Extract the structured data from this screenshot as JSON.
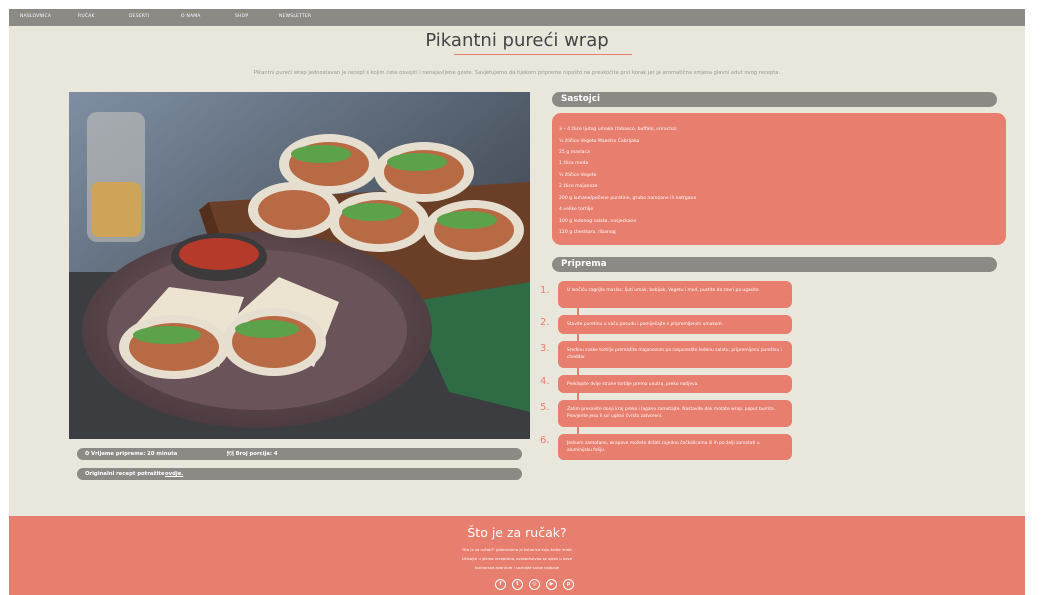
{
  "nav": {
    "items": [
      "NASLOVNICA",
      "RUČAK",
      "DESERTI",
      "O NAMA",
      "SHOP",
      "NEWSLETTER"
    ]
  },
  "header": {
    "title": "Pikantni pureći wrap",
    "intro": "Pikantni pureći wrap jednostavan je recept s kojim ćete osvojiti i nenajavljene goste. Savjetujemo da tijekom pripreme nipošto ne preskočite prvi korak jer je aromatična smjesa glavni adut ovog recepta."
  },
  "info": {
    "prep_time": "⏲ Vrijeme pripreme: 20 minuta",
    "servings": "🍽 Broj porcija: 4",
    "source_text": "Originalni recept potražite",
    "source_link": "ovdje."
  },
  "ingredients": {
    "title": "Sastojci",
    "items": [
      "3 – 4 žlice ljutog umaka (tabasco, buffalo, sriracha)",
      "½ žličice Vegeta Maestro Čabrijaka",
      "25 g maslaca",
      "1 žlica meda",
      "½ žličice Vegete",
      "2 žlice majoneze",
      "200 g kuhane/pečene puretine, grubo narezane ili natrgane",
      "4 velike tortilje",
      "100 g ledenog salata, nasjeckane",
      "120 g cheddara, ribanog"
    ]
  },
  "preparation": {
    "title": "Priprema",
    "steps": [
      {
        "num": "1.",
        "text": "U lončiću zagrijte maslac, ljuti umak, bebijak, Vegetu i med, pustite da zavri pa ugasite."
      },
      {
        "num": "2.",
        "text": "Stavite puretinu u vaču posudu i pomiješajte s pripremljenim umakom."
      },
      {
        "num": "3.",
        "text": "Sredinu svake tortilje premažite majonezom pa rasporedite ledenu salatu, pripremljenu puretinu i cheddar."
      },
      {
        "num": "4.",
        "text": "Preklopite dvije strane tortilje prema unutra, preko nadjeva."
      },
      {
        "num": "5.",
        "text": "Zatim presavite donji kraj preko i lagano zamotajte. Nastavite dok motate wrap, poput burrita. Provjerite jesu li svi uglovi čvrsto zatvoreni."
      },
      {
        "num": "6.",
        "text": "Jednom zamotane, wrapove možete držati zajedno čačkalicama ili ih po želji zamotati u aluminijsku foliju."
      }
    ]
  },
  "footer": {
    "title": "Što je za ručak?",
    "lines": [
      "\"Što je za ručak?\" jedinstvena je kuharica koju želite imati.",
      "Uživajte u jelima receptima, svakodnevno se sjesti u nove",
      "kulinarske avanture i saznajte svoje najbolje"
    ],
    "social": [
      {
        "icon": "facebook-icon",
        "glyph": "f"
      },
      {
        "icon": "twitter-icon",
        "glyph": "t"
      },
      {
        "icon": "instagram-icon",
        "glyph": "◎"
      },
      {
        "icon": "youtube-icon",
        "glyph": "▶"
      },
      {
        "icon": "pinterest-icon",
        "glyph": "p"
      }
    ]
  },
  "colors": {
    "accent": "#e87e6e",
    "nav_bg": "#8b8a85",
    "page_bg": "#e9e6dc"
  }
}
